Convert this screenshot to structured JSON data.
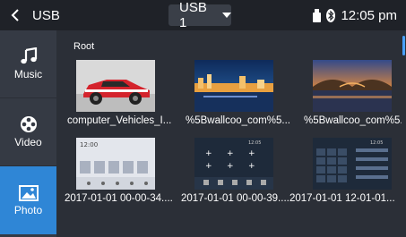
{
  "header": {
    "title": "USB",
    "source": "USB 1",
    "time": "12:05 pm"
  },
  "sidebar": {
    "items": [
      {
        "label": "Music",
        "icon": "music-note-icon"
      },
      {
        "label": "Video",
        "icon": "film-reel-icon"
      },
      {
        "label": "Photo",
        "icon": "image-icon"
      }
    ]
  },
  "breadcrumb": "Root",
  "files": [
    {
      "name": "computer_Vehicles_I...",
      "thumb": "race-car"
    },
    {
      "name": "%5Bwallcoo_com%5...",
      "thumb": "night-city"
    },
    {
      "name": "%5Bwallcoo_com%5...",
      "thumb": "bridge-sunset"
    },
    {
      "name": "2017-01-01 00-00-34....",
      "thumb": "ui-home",
      "thumb_text": "12:00"
    },
    {
      "name": "2017-01-01 00-00-39....",
      "thumb": "ui-keypad",
      "thumb_text": "12:05"
    },
    {
      "name": "2017-01-01 12-01-01...",
      "thumb": "ui-dialpad",
      "thumb_text": "12:05"
    }
  ]
}
